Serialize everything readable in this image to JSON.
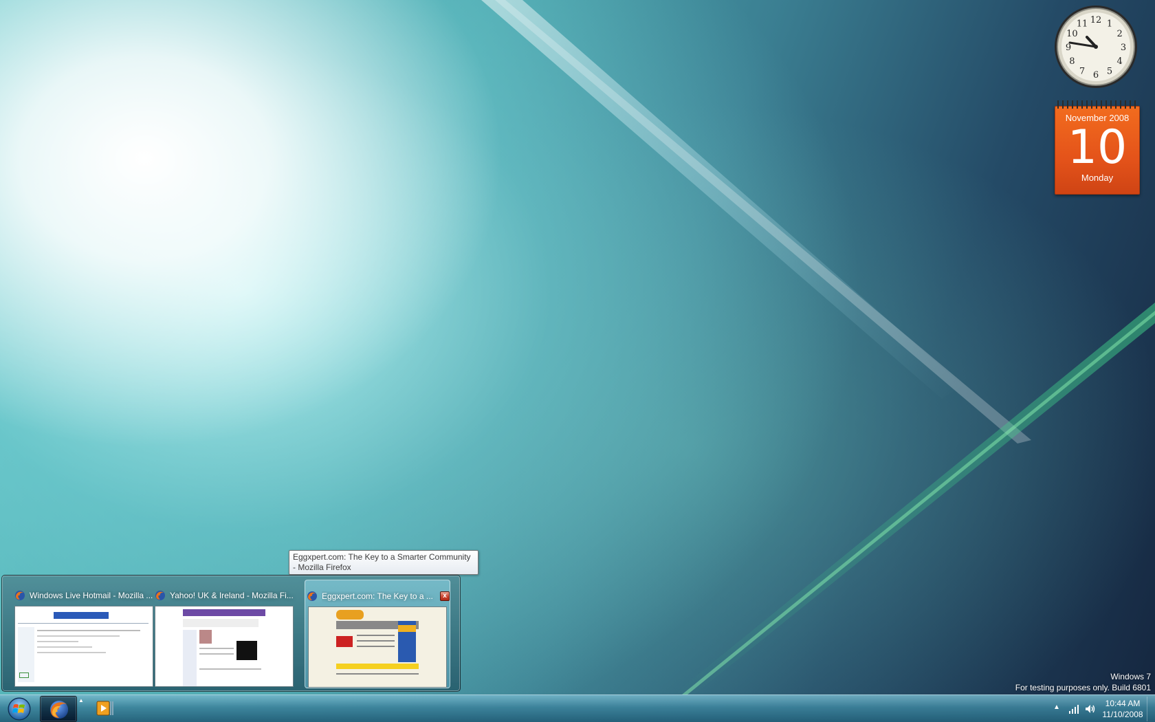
{
  "gadgets": {
    "clock": {
      "time": "10:44",
      "numerals": [
        "12",
        "1",
        "2",
        "3",
        "4",
        "5",
        "6",
        "7",
        "8",
        "9",
        "10",
        "11"
      ]
    },
    "calendar": {
      "month_year": "November 2008",
      "day": "10",
      "weekday": "Monday"
    }
  },
  "tooltip": {
    "text": "Eggxpert.com: The Key to a Smarter Community - Mozilla Firefox"
  },
  "thumbnails": [
    {
      "title": "Windows Live Hotmail - Mozilla ...",
      "icon": "firefox-icon",
      "active": false
    },
    {
      "title": "Yahoo! UK & Ireland - Mozilla Fi...",
      "icon": "firefox-icon",
      "active": false
    },
    {
      "title": "Eggxpert.com: The Key to a ...",
      "icon": "firefox-icon",
      "active": true,
      "close_label": "x"
    }
  ],
  "watermark": {
    "line1": "Windows 7",
    "line2": "For testing purposes only. Build 6801"
  },
  "taskbar": {
    "pinned": [
      "windows-start-orb-icon",
      "firefox-icon",
      "media-player-icon"
    ],
    "tray": {
      "chevron": "▲",
      "time": "10:44 AM",
      "date": "11/10/2008"
    }
  },
  "colors": {
    "calendar_accent": "#e4531a",
    "taskbar": "#3c8aa3"
  }
}
